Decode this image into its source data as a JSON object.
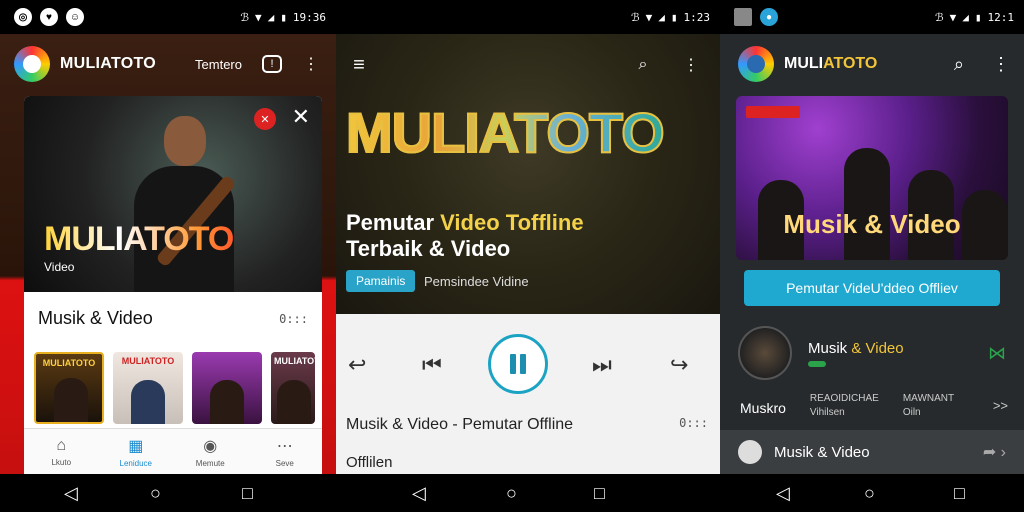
{
  "status": {
    "panel1_time": "19:36",
    "panel2_time": "1:23",
    "panel3_time": "12:1"
  },
  "panel1": {
    "brand": "MULIATOTO",
    "header_link": "Temtero",
    "hero_title": "MULIATOTO",
    "hero_subtitle": "Video",
    "section_title": "Musik & Video",
    "section_more": "0:::",
    "thumbs": [
      {
        "label": "MULIATOTO",
        "color": "#3a2a12"
      },
      {
        "label": "MULIATOTO",
        "color": "#e8e0d8"
      },
      {
        "label": "",
        "color": "#7a2a8a"
      },
      {
        "label": "MULIATOTO",
        "color": "#4a2a3a"
      }
    ],
    "bottom_nav": [
      {
        "label": "Lkuto",
        "icon": "home-icon"
      },
      {
        "label": "Leniduce",
        "icon": "library-icon"
      },
      {
        "label": "Memute",
        "icon": "discover-icon"
      },
      {
        "label": "Seve",
        "icon": "more-icon"
      }
    ]
  },
  "panel2": {
    "title": "MULIATOTO",
    "headline_line1_a": "Pemutar ",
    "headline_line1_b": "Video Toffline",
    "headline_line2": "Terbaik & Video",
    "chip_label": "Pamainis",
    "chip_sub": "Pemsindee Vidine",
    "track_title": "Musik & Video - Pemutar Offline",
    "track_time": "0:::",
    "track_mode": "Offlilen"
  },
  "panel3": {
    "brand_a": "MULI",
    "brand_b": "ATOTO",
    "banner_title": "Musik & Video",
    "cta_label": "Pemutar VideU'ddeo Offliev",
    "row_a_title_a": "Musik ",
    "row_a_title_b": "& Video",
    "row_b_label": "Muskro",
    "row_b_col1_line1": "REAOIDICHAE",
    "row_b_col1_line2": "Vihilsen",
    "row_b_col2_line1": "MAWNANT",
    "row_b_col2_line2": "Oiln",
    "row_b_go": ">>",
    "row_c_title": "Musik & Video"
  }
}
